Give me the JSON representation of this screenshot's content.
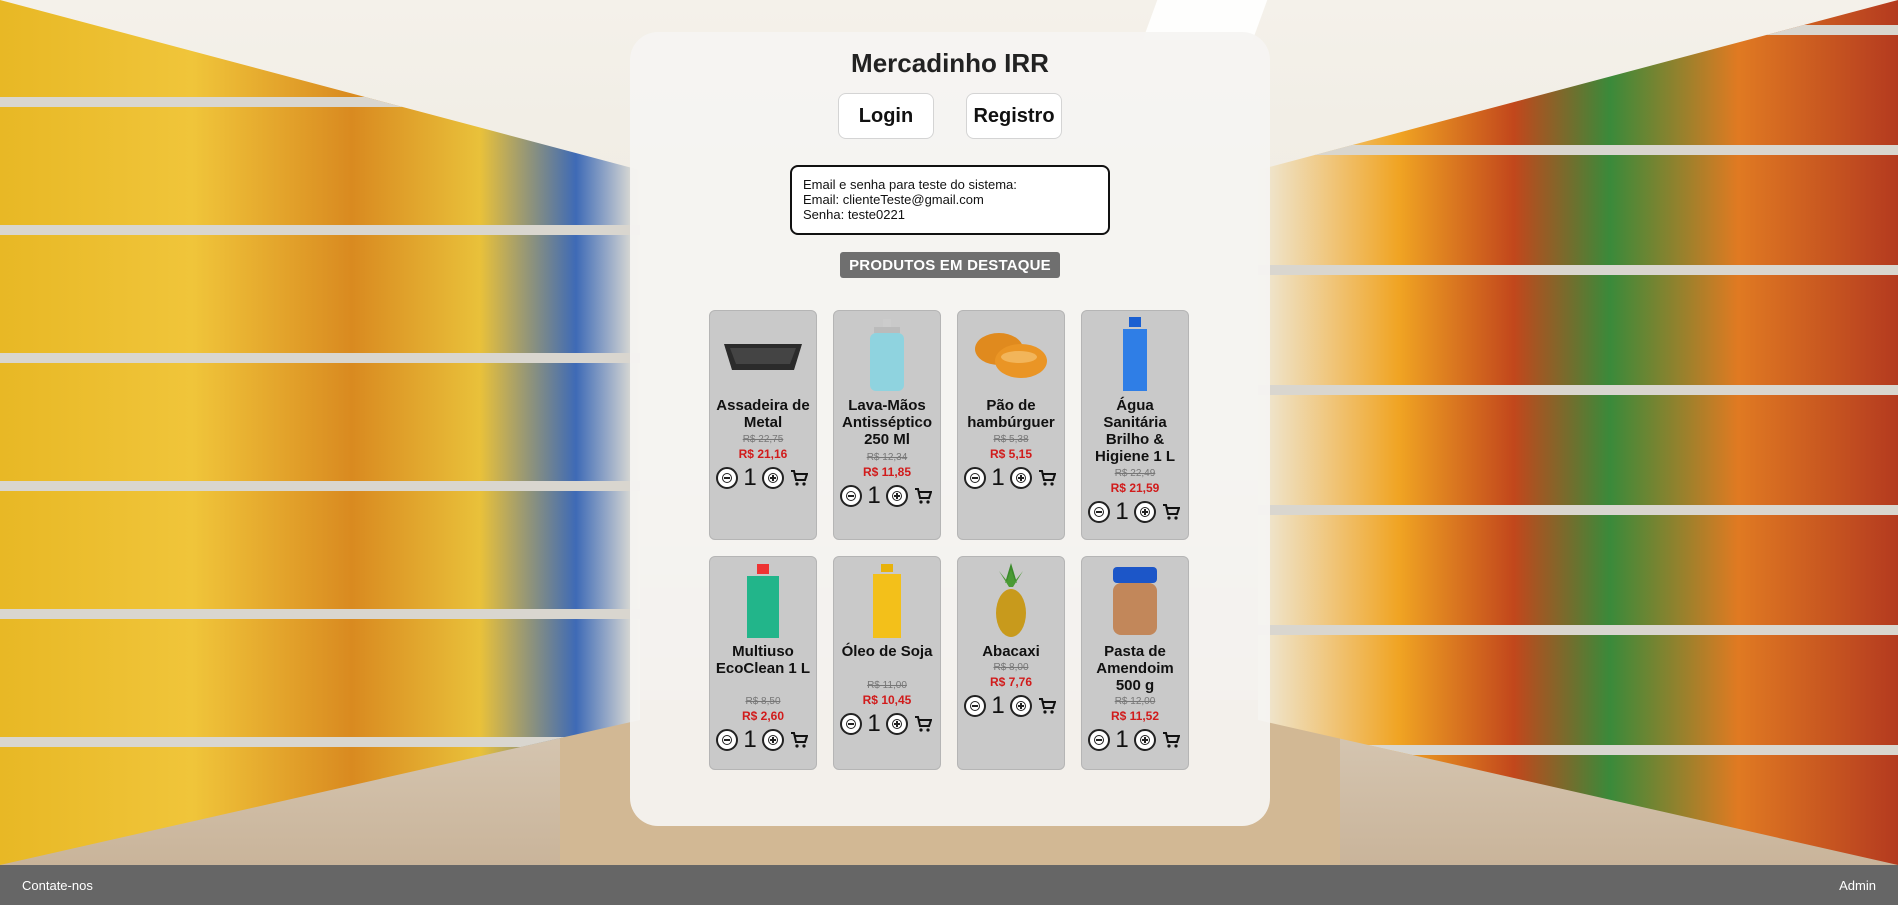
{
  "header": {
    "title": "Mercadinho IRR",
    "login_label": "Login",
    "register_label": "Registro"
  },
  "test_info": {
    "line1": "Email e senha para teste do sistema:",
    "line2": "Email: clienteTeste@gmail.com",
    "line3": "Senha: teste0221"
  },
  "featured_label": "PRODUTOS EM DESTAQUE",
  "products": [
    {
      "name": "Assadeira de Metal",
      "old_price": "R$ 22,75",
      "price": "R$ 21,16",
      "qty": "1",
      "icon": "baking-tray-icon"
    },
    {
      "name": "Lava-Mãos Antisséptico 250 Ml",
      "old_price": "R$ 12,34",
      "price": "R$ 11,85",
      "qty": "1",
      "icon": "soap-bottle-icon"
    },
    {
      "name": "Pão de hambúrguer",
      "old_price": "R$ 5,38",
      "price": "R$ 5,15",
      "qty": "1",
      "icon": "bread-icon"
    },
    {
      "name": "Água Sanitária Brilho & Higiene 1 L",
      "old_price": "R$ 22,49",
      "price": "R$ 21,59",
      "qty": "1",
      "icon": "bleach-bottle-icon"
    },
    {
      "name": "Multiuso EcoClean 1 L",
      "old_price": "R$ 8,50",
      "price": "R$ 2,60",
      "qty": "1",
      "icon": "cleaner-bottle-icon"
    },
    {
      "name": "Óleo de Soja",
      "old_price": "R$ 11,00",
      "price": "R$ 10,45",
      "qty": "1",
      "icon": "oil-bottle-icon"
    },
    {
      "name": "Abacaxi",
      "old_price": "R$ 8,00",
      "price": "R$ 7,76",
      "qty": "1",
      "icon": "pineapple-icon"
    },
    {
      "name": "Pasta de Amendoim 500 g",
      "old_price": "R$ 12,00",
      "price": "R$ 11,52",
      "qty": "1",
      "icon": "peanut-butter-jar-icon"
    }
  ],
  "footer": {
    "contact": "Contate-nos",
    "admin": "Admin"
  }
}
